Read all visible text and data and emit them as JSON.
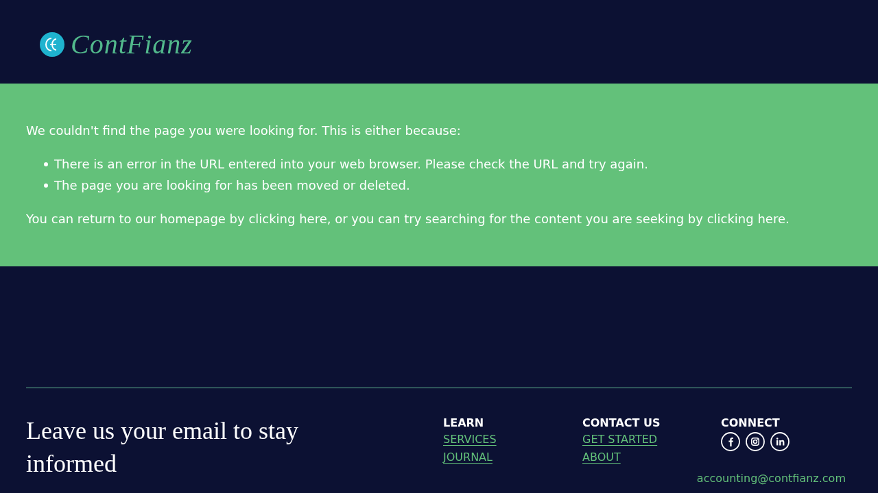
{
  "header": {
    "logo": {
      "wordmark": "ContFianz"
    }
  },
  "message": {
    "intro": "We couldn't find the page you were looking for. This is either because:",
    "reasons": [
      "There is an error in the URL entered into your web browser. Please check the URL and try again.",
      "The page you are looking for has been moved or deleted."
    ],
    "outro": "You can return to our homepage by clicking here, or you can try searching for the content you are seeking by clicking here."
  },
  "footer": {
    "newsletter_heading": "Leave us your email to stay informed",
    "columns": [
      {
        "kind": "links",
        "title": "LEARN",
        "links": [
          "SERVICES",
          "JOURNAL"
        ]
      },
      {
        "kind": "links",
        "title": "CONTACT US",
        "links": [
          "GET STARTED",
          "ABOUT"
        ]
      },
      {
        "kind": "social",
        "title": "CONNECT"
      }
    ],
    "email": "accounting@contfianz.com"
  }
}
